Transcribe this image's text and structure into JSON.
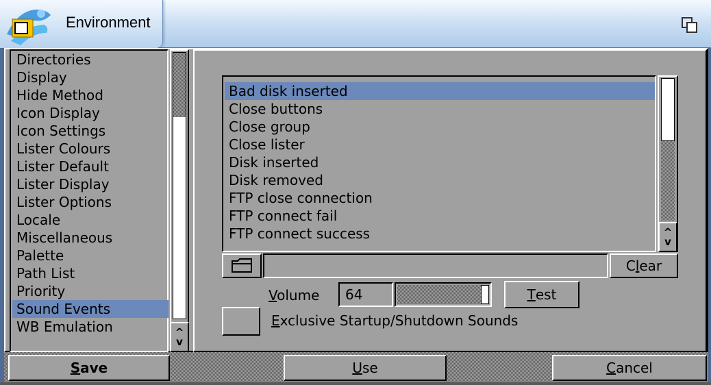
{
  "window": {
    "title": "Environment",
    "icon": "environment-app-icon",
    "depth_icon": "window-depth-icon"
  },
  "sidebar": {
    "items": [
      "Directories",
      "Display",
      "Hide Method",
      "Icon Display",
      "Icon Settings",
      "Lister Colours",
      "Lister Default",
      "Lister Display",
      "Lister Options",
      "Locale",
      "Miscellaneous",
      "Palette",
      "Path List",
      "Priority",
      "Sound Events",
      "WB Emulation"
    ],
    "selected": "Sound Events"
  },
  "events": {
    "items": [
      "Bad disk inserted",
      "Close buttons",
      "Close group",
      "Close lister",
      "Disk inserted",
      "Disk removed",
      "FTP close connection",
      "FTP connect fail",
      "FTP connect success"
    ],
    "selected": "Bad disk inserted",
    "path_value": "",
    "folder_icon": "folder-icon",
    "clear_label": {
      "pre": "C",
      "key": "l",
      "post": "ear"
    }
  },
  "volume": {
    "label": {
      "pre": "",
      "key": "V",
      "post": "olume"
    },
    "value": "64",
    "level": 0.64,
    "test_label": {
      "pre": "",
      "key": "T",
      "post": "est"
    }
  },
  "exclusive": {
    "label": {
      "pre": "",
      "key": "E",
      "post": "xclusive Startup/Shutdown Sounds"
    },
    "checked": false
  },
  "buttons": {
    "save": {
      "pre": "",
      "key": "S",
      "post": "ave"
    },
    "use": {
      "pre": "",
      "key": "U",
      "post": "se"
    },
    "cancel": {
      "pre": "",
      "key": "C",
      "post": "ancel"
    }
  },
  "scroll_arrows": {
    "up": "^",
    "down": "v"
  },
  "colors": {
    "background": "#a0a0a0",
    "selection": "#6b89bb",
    "titlebar": "#cfe1f4"
  }
}
